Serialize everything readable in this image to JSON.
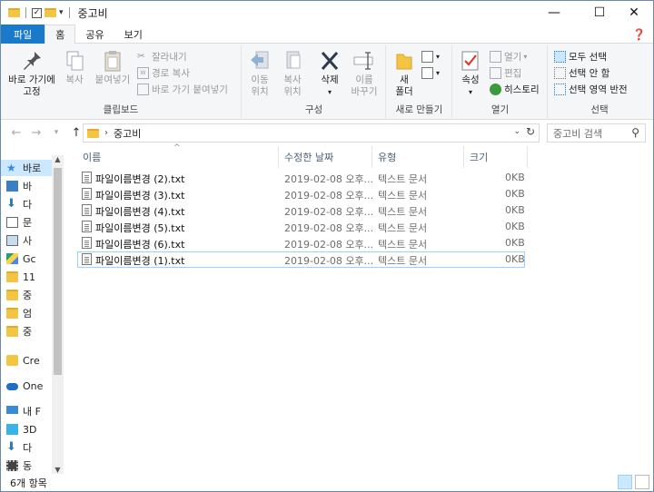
{
  "window": {
    "title": "중고비",
    "controls": {
      "minimize": "—",
      "maximize": "☐",
      "close": "✕"
    }
  },
  "tabs": [
    "파일",
    "홈",
    "공유",
    "보기"
  ],
  "ribbon": {
    "clipboard": {
      "group_name": "클립보드",
      "pin": "바로 가기에\n고정",
      "copy": "복사",
      "paste": "붙여넣기",
      "cut": "잘라내기",
      "copy_path": "경로 복사",
      "paste_shortcut": "바로 가기 붙여넣기"
    },
    "organize": {
      "group_name": "구성",
      "move_to": "이동\n위치",
      "copy_to": "복사\n위치",
      "delete": "삭제",
      "rename": "이름\n바꾸기"
    },
    "new": {
      "group_name": "새로 만들기",
      "new_folder": "새\n폴더"
    },
    "open": {
      "group_name": "열기",
      "properties": "속성",
      "open": "열기",
      "edit": "편집",
      "history": "히스토리"
    },
    "select": {
      "group_name": "선택",
      "select_all": "모두 선택",
      "select_none": "선택 안 함",
      "invert": "선택 영역 반전"
    }
  },
  "address": {
    "path": "중고비",
    "search_placeholder": "중고비 검색"
  },
  "navpane": [
    {
      "label": "바로",
      "icon": "star-icon",
      "selected": true
    },
    {
      "label": "바",
      "icon": "desktop-icon"
    },
    {
      "label": "다",
      "icon": "download-icon"
    },
    {
      "label": "문",
      "icon": "document-icon"
    },
    {
      "label": "사",
      "icon": "pictures-icon"
    },
    {
      "label": "Gc",
      "icon": "google-drive-icon"
    },
    {
      "label": "11",
      "icon": "folder-icon"
    },
    {
      "label": "중",
      "icon": "folder-icon"
    },
    {
      "label": "엄",
      "icon": "folder-icon"
    },
    {
      "label": "중",
      "icon": "folder-icon"
    },
    {
      "label": "Cre",
      "icon": "creative-cloud-icon"
    },
    {
      "label": "One",
      "icon": "onedrive-icon"
    },
    {
      "label": "내 F",
      "icon": "this-pc-icon"
    },
    {
      "label": "3D",
      "icon": "3d-objects-icon"
    },
    {
      "label": "다",
      "icon": "download-icon"
    },
    {
      "label": "동",
      "icon": "video-icon"
    }
  ],
  "columns": {
    "name": "이름",
    "date": "수정한 날짜",
    "type": "유형",
    "size": "크기"
  },
  "files": [
    {
      "name": "파일이름변경 (2).txt",
      "date": "2019-02-08 오후...",
      "type": "텍스트 문서",
      "size": "0KB"
    },
    {
      "name": "파일이름변경 (3).txt",
      "date": "2019-02-08 오후...",
      "type": "텍스트 문서",
      "size": "0KB"
    },
    {
      "name": "파일이름변경 (4).txt",
      "date": "2019-02-08 오후...",
      "type": "텍스트 문서",
      "size": "0KB"
    },
    {
      "name": "파일이름변경 (5).txt",
      "date": "2019-02-08 오후...",
      "type": "텍스트 문서",
      "size": "0KB"
    },
    {
      "name": "파일이름변경 (6).txt",
      "date": "2019-02-08 오후...",
      "type": "텍스트 문서",
      "size": "0KB"
    },
    {
      "name": "파일이름변경 (1).txt",
      "date": "2019-02-08 오후...",
      "type": "텍스트 문서",
      "size": "0KB"
    }
  ],
  "status": {
    "count": "6개 항목"
  },
  "colors": {
    "accent": "#1979ca",
    "selection": "#cce8ff",
    "folder": "#f4c443"
  }
}
